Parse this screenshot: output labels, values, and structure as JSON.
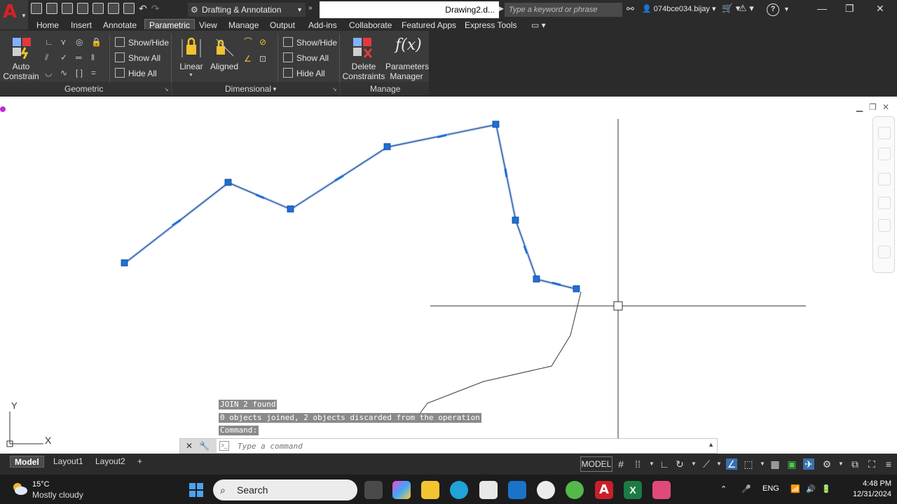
{
  "window": {
    "workspace": "Drafting & Annotation",
    "document_title": "Drawing2.d...",
    "search_placeholder": "Type a keyword or phrase",
    "user": "074bce034.bijay"
  },
  "ribbon": {
    "tabs": [
      "Home",
      "Insert",
      "Annotate",
      "Parametric",
      "View",
      "Manage",
      "Output",
      "Add-ins",
      "Collaborate",
      "Featured Apps",
      "Express Tools"
    ],
    "active_tab": "Parametric",
    "geometric": {
      "title": "Geometric",
      "auto_constrain_line1": "Auto",
      "auto_constrain_line2": "Constrain",
      "show_hide": "Show/Hide",
      "show_all": "Show All",
      "hide_all": "Hide All"
    },
    "dimensional": {
      "title": "Dimensional",
      "linear": "Linear",
      "aligned": "Aligned",
      "show_hide": "Show/Hide",
      "show_all": "Show All",
      "hide_all": "Hide All"
    },
    "manage": {
      "title": "Manage",
      "delete_line1": "Delete",
      "delete_line2": "Constraints",
      "params_line1": "Parameters",
      "params_line2": "Manager",
      "fx_glyph": "f(x)"
    }
  },
  "command": {
    "history": [
      "JOIN 2 found",
      "0 objects joined, 2 objects discarded from the operation",
      "Command:"
    ],
    "placeholder": "Type a command"
  },
  "ucs": {
    "y_label": "Y",
    "x_label": "X"
  },
  "layout_tabs": [
    "Model",
    "Layout1",
    "Layout2"
  ],
  "add_tab": "+",
  "status": {
    "model_button": "MODEL"
  },
  "taskbar": {
    "temperature": "15°C",
    "weather": "Mostly cloudy",
    "search_label": "Search",
    "language": "ENG",
    "time": "4:48 PM",
    "date": "12/31/2024"
  },
  "colors": {
    "accent_blue": "#1e6fd9",
    "autocad_red": "#d92028",
    "ribbon_bg": "#3b3b3b",
    "titlebar_bg": "#2b2b2b"
  }
}
